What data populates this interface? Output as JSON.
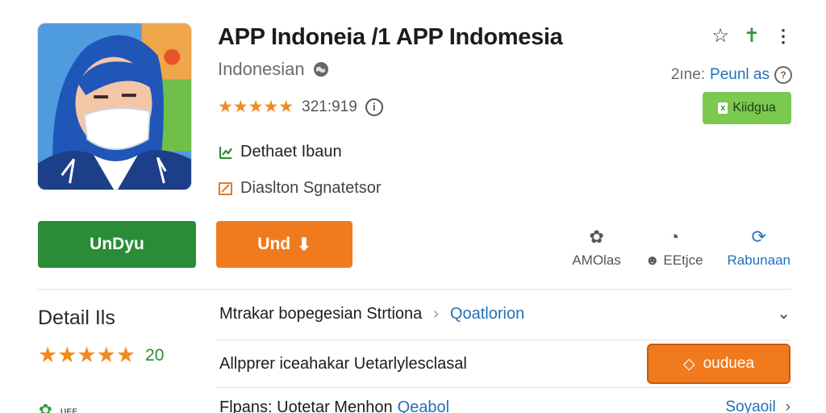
{
  "app": {
    "title": "APP Indoneia /1 APP Indomesia",
    "subtitle": "Indonesian",
    "stars": "★★★★★",
    "rating_count": "321:919",
    "feature_1": "Dethaet Ibaun",
    "feature_2": "Diaslton Sgnatetsor"
  },
  "top_icons": {
    "star": "☆",
    "person": "✝",
    "menu": "⋮"
  },
  "partner": {
    "label": "2ıne:",
    "value": "Peunl as",
    "help": "?"
  },
  "badge": {
    "icon": "x",
    "label": "Kiidgua"
  },
  "buttons": {
    "primary": "UnDyu",
    "secondary": "Und",
    "secondary_icon": "⬇"
  },
  "actions": [
    {
      "icon": "✿",
      "label": "AMOlas"
    },
    {
      "icon": "◔",
      "label": "☻ EEtjce"
    },
    {
      "icon": "⟳",
      "label": "Rabunaan"
    }
  ],
  "details": {
    "title": "Detail Ils",
    "stars": "★★★★★",
    "count": "20"
  },
  "rows": {
    "row1_text": "Mtrakar bopegesian Strtiona",
    "row1_chevron": "›",
    "row1_link": "Qoatlorion",
    "row1_right": "⌄",
    "row2_text": "Allpprer iceahakar Uetarlylesclasal",
    "row2_button_icon": "◇",
    "row2_button": "ouduea",
    "row3_text": "Flpans: Uotetar Menhon",
    "row3_link": "Qeabol",
    "row3_right": "Soyaoil",
    "row3_chevron": "›"
  },
  "bottom_left": {
    "icon": "✿",
    "label": "ᴜᴇᴇ"
  },
  "colors": {
    "green": "#2a8c36",
    "orange": "#f07b1e",
    "link_blue": "#2470b8",
    "star_orange": "#f28a1c"
  }
}
